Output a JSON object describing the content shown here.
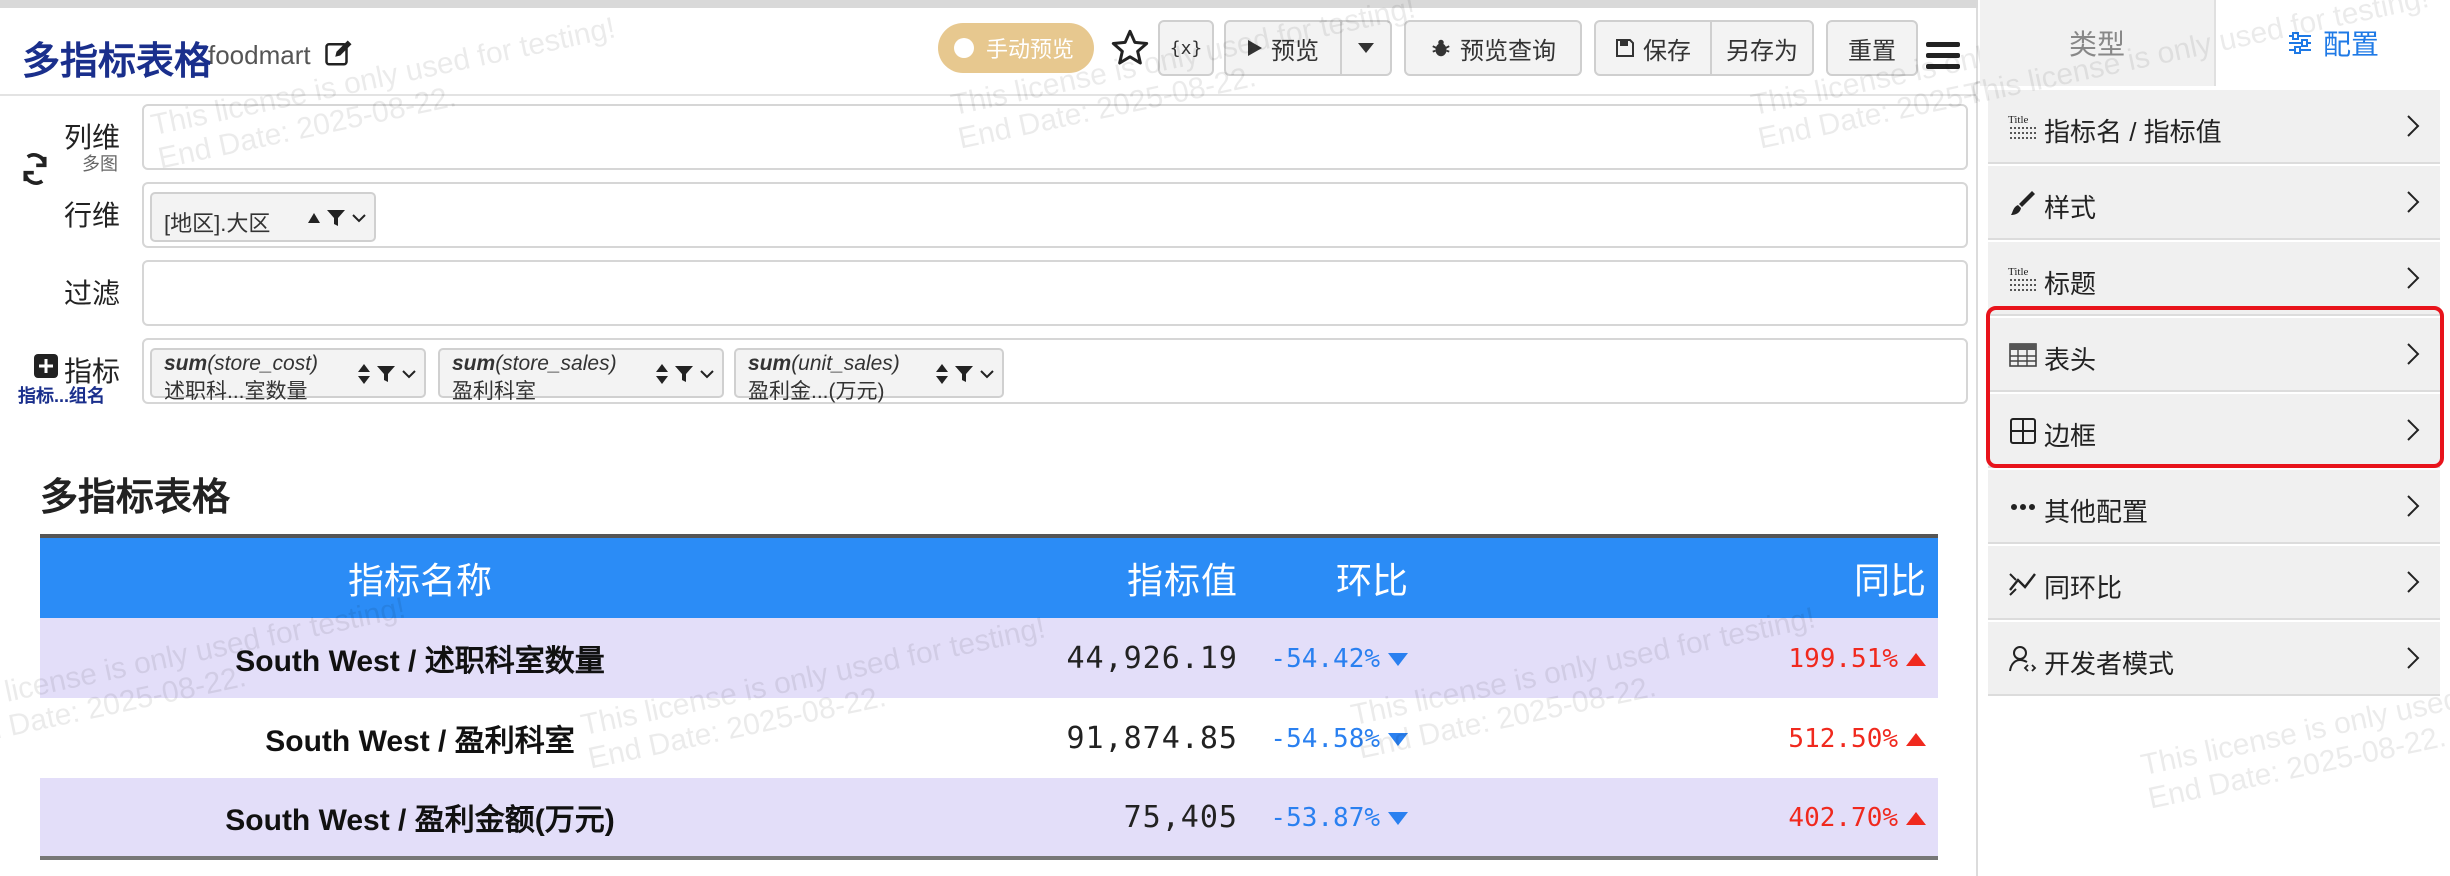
{
  "header": {
    "title": "多指标表格",
    "subtitle": "foodmart",
    "toggle_label": "手动预览",
    "var_button": "{x}",
    "preview_label": "预览",
    "preview_query_label": "预览查询",
    "save_label": "保存",
    "save_as_label": "另存为",
    "reset_label": "重置"
  },
  "config": {
    "columns_label": "列维",
    "columns_sub": "多图",
    "rows_label": "行维",
    "filter_label": "过滤",
    "measures_label": "指标",
    "measures_sub": "指标...组名",
    "row_chip": "[地区].大区",
    "measure_chips": [
      {
        "func": "sum",
        "field": "(store_cost)",
        "alias": "述职科...室数量"
      },
      {
        "func": "sum",
        "field": "(store_sales)",
        "alias": "盈利科室"
      },
      {
        "func": "sum",
        "field": "(unit_sales)",
        "alias": "盈利金...(万元)"
      }
    ]
  },
  "report": {
    "title": "多指标表格",
    "columns": [
      "指标名称",
      "指标值",
      "环比",
      "同比"
    ],
    "rows": [
      {
        "name": "South West / 述职科室数量",
        "value": "44,926.19",
        "mom": "-54.42%",
        "yoy": "199.51%"
      },
      {
        "name": "South West / 盈利科室",
        "value": "91,874.85",
        "mom": "-54.58%",
        "yoy": "512.50%"
      },
      {
        "name": "South West / 盈利金额(万元)",
        "value": "75,405",
        "mom": "-53.87%",
        "yoy": "402.70%"
      }
    ]
  },
  "sidebar": {
    "tabs": [
      "类型",
      "配置"
    ],
    "panels": [
      {
        "label": "指标名 / 指标值",
        "icon": "title-icon"
      },
      {
        "label": "样式",
        "icon": "brush-icon"
      },
      {
        "label": "标题",
        "icon": "title-icon"
      },
      {
        "label": "表头",
        "icon": "table-header-icon"
      },
      {
        "label": "边框",
        "icon": "border-icon"
      },
      {
        "label": "其他配置",
        "icon": "ellipsis-icon"
      },
      {
        "label": "同环比",
        "icon": "trend-icon"
      },
      {
        "label": "开发者模式",
        "icon": "developer-icon"
      }
    ]
  },
  "watermark": {
    "line1": "This license is only used for testing!",
    "line2": "End Date: 2025-08-22."
  },
  "colors": {
    "header_bg": "#2b8cf6",
    "odd_row": "#e3def9",
    "negative": "#2a80f0",
    "positive": "#f0291e",
    "highlight": "#e8131b",
    "toggle": "#e7c88f"
  }
}
